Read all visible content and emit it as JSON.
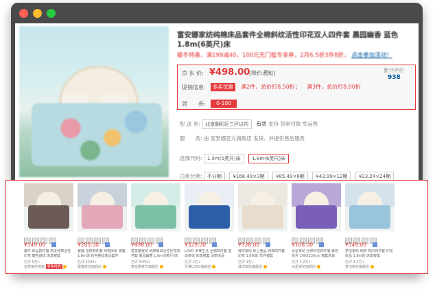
{
  "window": {
    "controls": [
      "close",
      "minimize",
      "maximize"
    ],
    "colors": {
      "close": "#ff5f57",
      "minimize": "#febc2e",
      "maximize": "#28c840"
    }
  },
  "product": {
    "title": "富安娜家纺纯棉床品套件全棉斜纹活性印花双人四件套 晨园幽香 蓝色 1.8m(6英尺)床",
    "promo_text": "暖冬特惠，满199减40，100元无门槛专享券，2月6.5折3件8折，",
    "promo_link": "点击参加活动！",
    "price_label": "京 东 价:",
    "price": "¥498.00",
    "price_notify": "[降价通知]",
    "promo_label": "促销信息:",
    "promo_tag": "多买优惠",
    "promo_rule1": "满2件，总价打8.50折；",
    "promo_rule2": "满3件，总价打8.00折",
    "coupon_label": "领　　券:",
    "coupon": "0-100",
    "review_label": "累计评价",
    "review_count": "938",
    "ship_label": "配 送 至:",
    "ship_location": "北京朝阳区三环以内",
    "ship_status": "有货",
    "ship_note": "支持 货到付款  免运费",
    "service_label": "服　　务:",
    "service_text": "由 富安娜官方旗舰店 发货，并提供售后服务",
    "size_label": "选择尺码:",
    "sizes": [
      "1.5m(5英尺)床",
      "1.8m(6英尺)床"
    ],
    "selected_size": "1.8m(6英尺)床",
    "bundle_label": "白条分期:",
    "bundles": [
      "不分期",
      "¥168.49×3期",
      "¥85.49×6期",
      "¥43.99×12期",
      "¥23.24×24期"
    ],
    "accent": "#e4393c"
  },
  "recommend": {
    "items": [
      {
        "price": "¥149.00",
        "name": "套件 床品四件套 高支纯棉活性印花 磨毛斜纹 床单被套 1.5/1.8米床 四件套",
        "meta": "已评 5万+",
        "shop": "友邦家纺官旗",
        "hot": "多色可选",
        "colors": {
          "wall": "#d9d2c8",
          "bed": "#6b5a55"
        }
      },
      {
        "price": "¥285.00",
        "name": "雅鹿 全棉四件套 纯棉床单 被套 1.8m床 粉色格纹床品套件",
        "meta": "已评 5300+",
        "shop": "雅鹿家纺旗舰店",
        "hot": "",
        "colors": {
          "wall": "#c9d2da",
          "bed": "#e3a8b8"
        }
      },
      {
        "price": "¥498.00",
        "name": "富安娜家纺 纯棉斜纹活性印花四件套 晨园幽香 1.8m(6英尺)床",
        "meta": "已评 5300+",
        "shop": "富安娜官方旗舰店",
        "hot": "",
        "colors": {
          "wall": "#d6ece8",
          "bed": "#7cc0a6"
        }
      },
      {
        "price": "¥329.00",
        "name": "LOVO 罗莱生活 全棉四件套 蓝白条纹 床单被套 清新床品",
        "meta": "已评 2万+",
        "shop": "罗莱LOVO旗舰店",
        "hot": "",
        "colors": {
          "wall": "#e8eef4",
          "bed": "#2f5ea8"
        }
      },
      {
        "price": "¥338.00",
        "name": "博洋家纺 床上用品 纯棉四件套 印花 1.8米床 花卉被套",
        "meta": "已评 1万+",
        "shop": "博洋家纺旗舰店",
        "hot": "",
        "colors": {
          "wall": "#ece8e2",
          "bed": "#e8dccc"
        }
      },
      {
        "price": "¥168.00",
        "name": "水星家纺 全棉印花四件套 紫色花卉 200X230cm 被套床单",
        "meta": "已评 4.2万+",
        "shop": "水星家纺旗舰店",
        "hot": "",
        "colors": {
          "wall": "#b8a8d8",
          "bed": "#7a5fb8"
        }
      },
      {
        "price": "¥149.00",
        "name": "梦洁家纺 纯棉 简约四件套 印花床品 1.8m床 床单被罩",
        "meta": "已评 4.2万+",
        "shop": "梦洁家纺旗舰店",
        "hot": "",
        "colors": {
          "wall": "#d4e2ec",
          "bed": "#9ac3dc"
        }
      }
    ]
  }
}
